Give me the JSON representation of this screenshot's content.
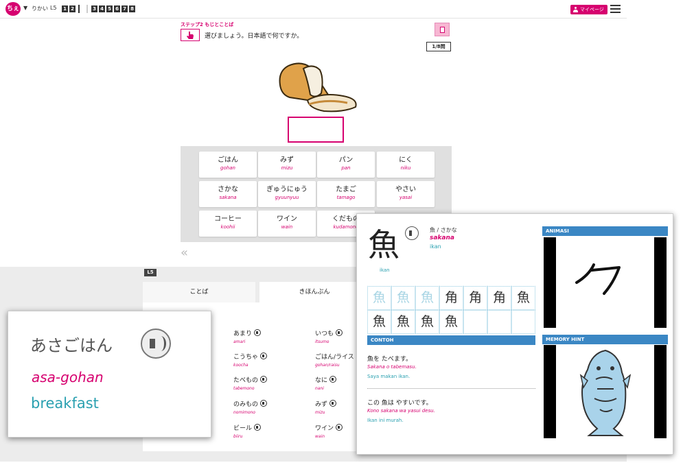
{
  "topbar": {
    "logo_text": "ちぇ",
    "caret": "▼",
    "course": "りかい",
    "lesson": "L5",
    "steps_group1": [
      "1",
      "2"
    ],
    "steps_group2": [
      "3",
      "4",
      "5",
      "6",
      "7",
      "8"
    ],
    "mypage_label": "マイページ"
  },
  "quiz": {
    "step_title": "ステップ2 もじとことば",
    "question": "選びましょう。日本語で何ですか。",
    "counter": "1/8問",
    "options": [
      {
        "jp": "ごはん",
        "ro": "gohan"
      },
      {
        "jp": "みず",
        "ro": "mizu"
      },
      {
        "jp": "パン",
        "ro": "pan"
      },
      {
        "jp": "にく",
        "ro": "niku"
      },
      {
        "jp": "さかな",
        "ro": "sakana"
      },
      {
        "jp": "ぎゅうにゅう",
        "ro": "gyuunyuu"
      },
      {
        "jp": "たまご",
        "ro": "tamago"
      },
      {
        "jp": "やさい",
        "ro": "yasai"
      },
      {
        "jp": "コーヒー",
        "ro": "koohii"
      },
      {
        "jp": "ワイン",
        "ro": "wain"
      },
      {
        "jp": "くだもの",
        "ro": "kudamono"
      }
    ],
    "back_arrows": "«"
  },
  "lesson": {
    "tag": "L5",
    "tabs": [
      "ことば",
      "きほんぶん"
    ],
    "words_col1": [
      {
        "jp": "あまり",
        "ro": "amari"
      },
      {
        "jp": "こうちゃ",
        "ro": "koocha"
      },
      {
        "jp": "たべもの",
        "ro": "tabemono"
      },
      {
        "jp": "のみもの",
        "ro": "nomimono"
      },
      {
        "jp": "ビール",
        "ro": "biiru"
      }
    ],
    "words_col2": [
      {
        "jp": "いつも",
        "ro": "itsumo"
      },
      {
        "jp": "ごはん/ライス",
        "ro": "gohan/raisu"
      },
      {
        "jp": "なに",
        "ro": "nani"
      },
      {
        "jp": "みず",
        "ro": "mizu"
      },
      {
        "jp": "ワイン",
        "ro": "wain"
      }
    ]
  },
  "word_card": {
    "jp": "あさごはん",
    "ro": "asa-gohan",
    "en": "breakfast"
  },
  "kanji_card": {
    "kanji": "魚",
    "reading": "魚 / さかな",
    "romaji": "sakana",
    "meaning": "ikan",
    "meaning_small": "ikan",
    "stroke_cells": [
      "魚",
      "魚",
      "魚",
      "角",
      "角",
      "角",
      "魚",
      "魚",
      "魚",
      "魚",
      "魚"
    ],
    "contoh_label": "CONTOH",
    "examples": [
      {
        "jp": "魚を たべます。",
        "ro": "Sakana o tabemasu.",
        "id": "Saya makan ikan."
      },
      {
        "jp": "この 魚は やすいです。",
        "ro": "Kono sakana wa yasui desu.",
        "id": "Ikan ini murah."
      }
    ],
    "animasi_label": "ANIMASI",
    "hint_label": "MEMORY HINT"
  },
  "colors": {
    "brand": "#d6006f",
    "teal": "#2aa0b0",
    "header_blue": "#3b87c4"
  }
}
